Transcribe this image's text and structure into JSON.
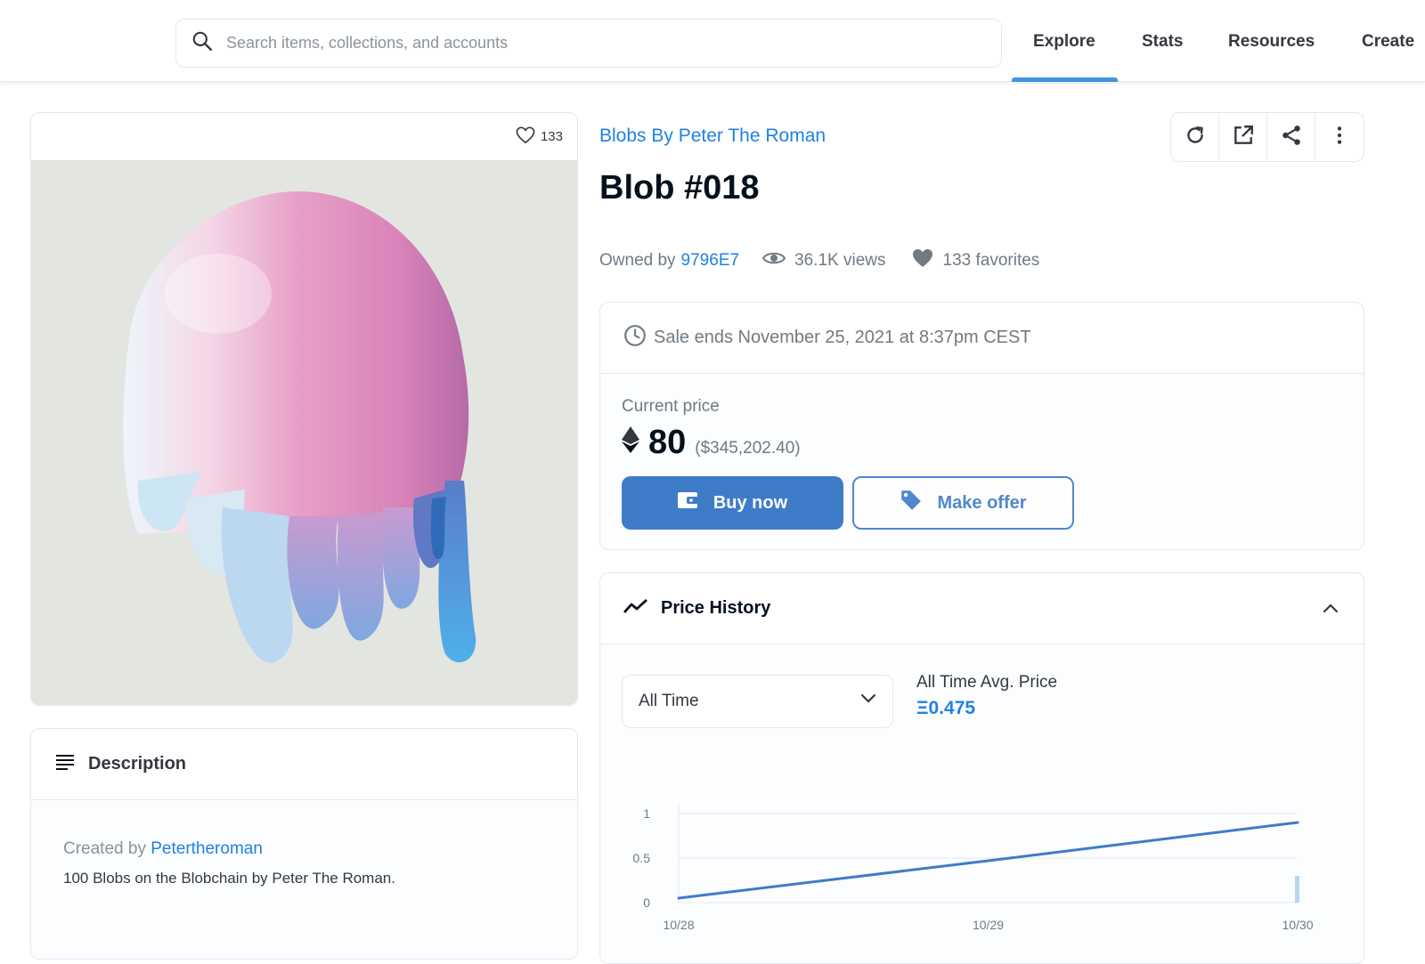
{
  "search": {
    "placeholder": "Search items, collections, and accounts"
  },
  "nav": {
    "explore": "Explore",
    "stats": "Stats",
    "resources": "Resources",
    "create": "Create"
  },
  "image_card": {
    "favorites_count": "133"
  },
  "item": {
    "collection": "Blobs By Peter The Roman",
    "title": "Blob #018",
    "owned_by_label": "Owned by",
    "owner": "9796E7",
    "views": "36.1K views",
    "favorites": "133 favorites"
  },
  "sale": {
    "ends_text": "Sale ends November 25, 2021 at 8:37pm CEST",
    "current_price_label": "Current price",
    "price_eth": "80",
    "price_usd": "($345,202.40)",
    "buy_label": "Buy now",
    "offer_label": "Make offer"
  },
  "price_history": {
    "title": "Price History",
    "range_selected": "All Time",
    "avg_label": "All Time Avg. Price",
    "avg_value": "Ξ0.475"
  },
  "description": {
    "title": "Description",
    "created_by_label": "Created by",
    "creator": "Petertheroman",
    "text": "100 Blobs on the Blobchain by Peter The Roman."
  },
  "colors": {
    "accent": "#2081e2",
    "button": "#3e7cc8"
  },
  "chart_data": {
    "type": "line",
    "x": [
      "10/28",
      "10/29",
      "10/30"
    ],
    "series": [
      {
        "values": [
          0.05,
          0.47,
          0.9
        ]
      }
    ],
    "y_ticks": [
      "1",
      "0.5",
      "0"
    ],
    "ylim": [
      0,
      1
    ],
    "grid": true,
    "volume_bar": {
      "x": "10/30",
      "relative_height": 0.3
    }
  }
}
